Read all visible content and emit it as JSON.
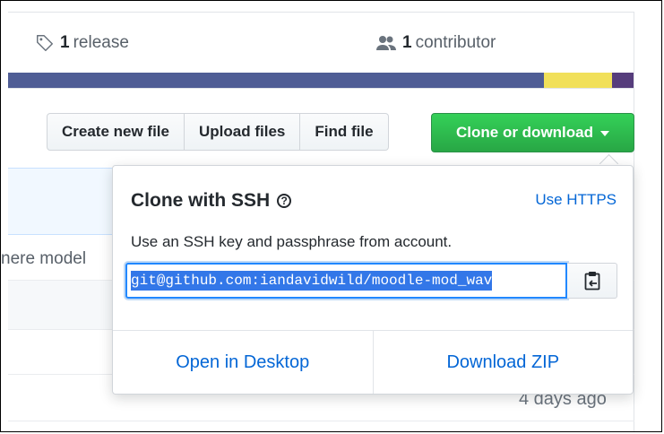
{
  "summary": {
    "release_count": "1",
    "release_label": "release",
    "contributor_count": "1",
    "contributor_label": "contributor"
  },
  "language_bar": {
    "colors": [
      "#4f5d95",
      "#f1e05a",
      "#563d7c"
    ]
  },
  "toolbar": {
    "create_new_file": "Create new file",
    "upload_files": "Upload files",
    "find_file": "Find file",
    "clone_or_download": "Clone or download"
  },
  "background": {
    "commit_text_fragment": "nere model",
    "date": "4 days ago"
  },
  "clone_popover": {
    "title": "Clone with SSH",
    "use_https": "Use HTTPS",
    "description": "Use an SSH key and passphrase from account.",
    "url": "git@github.com:iandavidwild/moodle-mod_wav",
    "open_in_desktop": "Open in Desktop",
    "download_zip": "Download ZIP"
  },
  "colors": {
    "accent_green": "#28a745",
    "link_blue": "#0366d6"
  }
}
